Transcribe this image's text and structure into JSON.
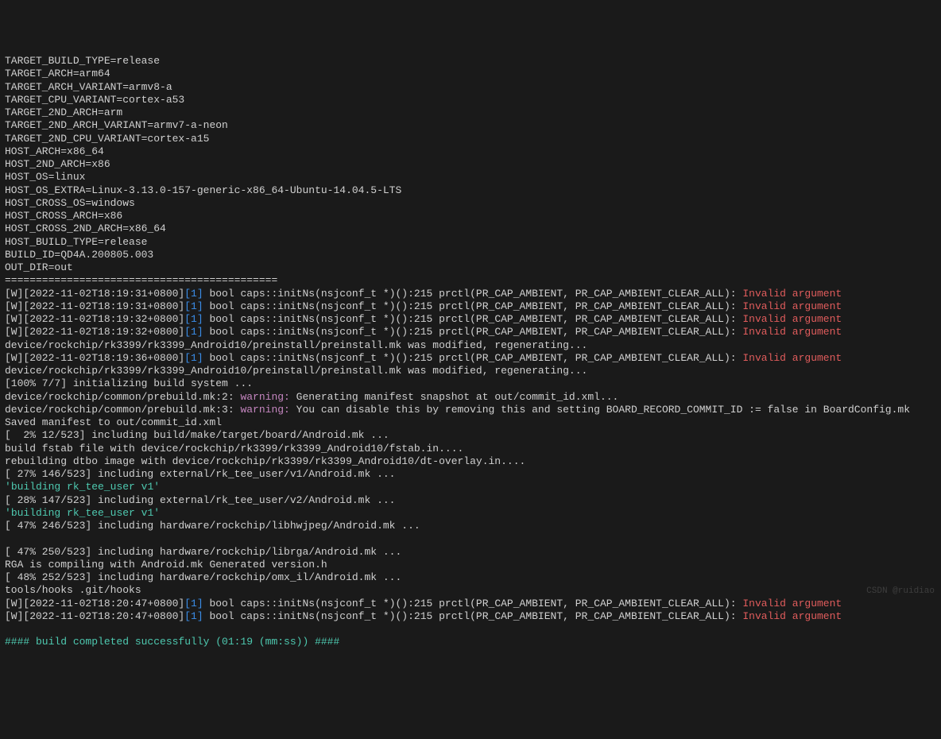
{
  "env_lines": [
    "TARGET_BUILD_TYPE=release",
    "TARGET_ARCH=arm64",
    "TARGET_ARCH_VARIANT=armv8-a",
    "TARGET_CPU_VARIANT=cortex-a53",
    "TARGET_2ND_ARCH=arm",
    "TARGET_2ND_ARCH_VARIANT=armv7-a-neon",
    "TARGET_2ND_CPU_VARIANT=cortex-a15",
    "HOST_ARCH=x86_64",
    "HOST_2ND_ARCH=x86",
    "HOST_OS=linux",
    "HOST_OS_EXTRA=Linux-3.13.0-157-generic-x86_64-Ubuntu-14.04.5-LTS",
    "HOST_CROSS_OS=windows",
    "HOST_CROSS_ARCH=x86",
    "HOST_CROSS_2ND_ARCH=x86_64",
    "HOST_BUILD_TYPE=release",
    "BUILD_ID=QD4A.200805.003",
    "OUT_DIR=out",
    "============================================"
  ],
  "warn1": {
    "prefix": "[W][2022-11-02T18:19:31+0800]",
    "idx": "[1]",
    "body": " bool caps::initNs(nsjconf_t *)():215 prctl(PR_CAP_AMBIENT, PR_CAP_AMBIENT_CLEAR_ALL): ",
    "err": "Invalid argument"
  },
  "warn2": {
    "prefix": "[W][2022-11-02T18:19:31+0800]",
    "idx": "[1]",
    "body": " bool caps::initNs(nsjconf_t *)():215 prctl(PR_CAP_AMBIENT, PR_CAP_AMBIENT_CLEAR_ALL): ",
    "err": "Invalid argument"
  },
  "warn3": {
    "prefix": "[W][2022-11-02T18:19:32+0800]",
    "idx": "[1]",
    "body": " bool caps::initNs(nsjconf_t *)():215 prctl(PR_CAP_AMBIENT, PR_CAP_AMBIENT_CLEAR_ALL): ",
    "err": "Invalid argument"
  },
  "warn4": {
    "prefix": "[W][2022-11-02T18:19:32+0800]",
    "idx": "[1]",
    "body": " bool caps::initNs(nsjconf_t *)():215 prctl(PR_CAP_AMBIENT, PR_CAP_AMBIENT_CLEAR_ALL): ",
    "err": "Invalid argument"
  },
  "regen1": "device/rockchip/rk3399/rk3399_Android10/preinstall/preinstall.mk was modified, regenerating...",
  "warn5": {
    "prefix": "[W][2022-11-02T18:19:36+0800]",
    "idx": "[1]",
    "body": " bool caps::initNs(nsjconf_t *)():215 prctl(PR_CAP_AMBIENT, PR_CAP_AMBIENT_CLEAR_ALL): ",
    "err": "Invalid argument"
  },
  "regen2": "device/rockchip/rk3399/rk3399_Android10/preinstall/preinstall.mk was modified, regenerating...",
  "init": "[100% 7/7] initializing build system ...",
  "prebuild1": {
    "path": "device/rockchip/common/prebuild.mk:2: ",
    "tag": "warning:",
    "msg": " Generating manifest snapshot at out/commit_id.xml..."
  },
  "prebuild2": {
    "path": "device/rockchip/common/prebuild.mk:3: ",
    "tag": "warning:",
    "msg": " You can disable this by removing this and setting BOARD_RECORD_COMMIT_ID := false in BoardConfig.mk"
  },
  "saved": "Saved manifest to out/commit_id.xml",
  "inc1": "[  2% 12/523] including build/make/target/board/Android.mk ...",
  "fstab": "build fstab file with device/rockchip/rk3399/rk3399_Android10/fstab.in....",
  "dtbo": "rebuilding dtbo image with device/rockchip/rk3399/rk3399_Android10/dt-overlay.in....",
  "inc2": "[ 27% 146/523] including external/rk_tee_user/v1/Android.mk ...",
  "tee1": {
    "q1": "'",
    "b": "building",
    "rest": " rk_tee_user v1'"
  },
  "inc3": "[ 28% 147/523] including external/rk_tee_user/v2/Android.mk ...",
  "tee2": {
    "q1": "'",
    "b": "building",
    "rest": " rk_tee_user v1'"
  },
  "inc4": "[ 47% 246/523] including hardware/rockchip/libhwjpeg/Android.mk ...",
  "blank": "",
  "inc5": "[ 47% 250/523] including hardware/rockchip/librga/Android.mk ...",
  "rga": "RGA is compiling with Android.mk Generated version.h",
  "inc6": "[ 48% 252/523] including hardware/rockchip/omx_il/Android.mk ...",
  "hooks": "tools/hooks .git/hooks",
  "warn6": {
    "prefix": "[W][2022-11-02T18:20:47+0800]",
    "idx": "[1]",
    "body": " bool caps::initNs(nsjconf_t *)():215 prctl(PR_CAP_AMBIENT, PR_CAP_AMBIENT_CLEAR_ALL): ",
    "err": "Invalid argument"
  },
  "warn7": {
    "prefix": "[W][2022-11-02T18:20:47+0800]",
    "idx": "[1]",
    "body": " bool caps::initNs(nsjconf_t *)():215 prctl(PR_CAP_AMBIENT, PR_CAP_AMBIENT_CLEAR_ALL): ",
    "err": "Invalid argument"
  },
  "success": "#### build completed successfully (01:19 (mm:ss)) ####",
  "watermark": "CSDN @ruidiao"
}
